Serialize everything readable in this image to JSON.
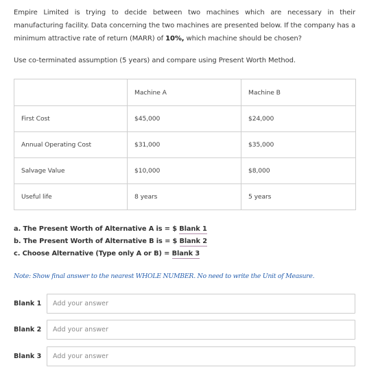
{
  "intro": {
    "text_before": "Empire Limited is trying to decide between two machines which are necessary in their manufacturing facility. Data concerning the two machines are presented below. If the company has a minimum attractive rate of return (MARR) of ",
    "marr_bold": "10%,",
    "text_after": " which machine should be chosen?"
  },
  "instruction": "Use co-terminated assumption (5 years) and compare using Present Worth Method.",
  "table": {
    "headers": [
      "",
      "Machine A",
      "Machine B"
    ],
    "rows": [
      [
        "First Cost",
        "$45,000",
        "$24,000"
      ],
      [
        "Annual Operating Cost",
        "$31,000",
        "$35,000"
      ],
      [
        "Salvage Value",
        "$10,000",
        "$8,000"
      ],
      [
        "Useful life",
        "8 years",
        "5 years"
      ]
    ]
  },
  "questions": [
    {
      "prefix": "a. The Present Worth of Alternative A is = $ ",
      "blank": "Blank 1"
    },
    {
      "prefix": "b. The Present Worth of Alternative B is = $ ",
      "blank": "Blank 2"
    },
    {
      "prefix": "c. Choose Alternative (Type only A or B) = ",
      "blank": "Blank 3"
    }
  ],
  "note": "Note: Show final answer to the nearest WHOLE NUMBER. No need to write the Unit of Measure.",
  "answers": [
    {
      "label": "Blank 1",
      "value": "",
      "placeholder": "Add your answer"
    },
    {
      "label": "Blank 2",
      "value": "",
      "placeholder": "Add your answer"
    },
    {
      "label": "Blank 3",
      "value": "",
      "placeholder": "Add your answer"
    }
  ],
  "colors": {
    "note_text": "#2a62b0",
    "blank_underline": "#b08aa8",
    "table_border": "#cfcfcf"
  }
}
